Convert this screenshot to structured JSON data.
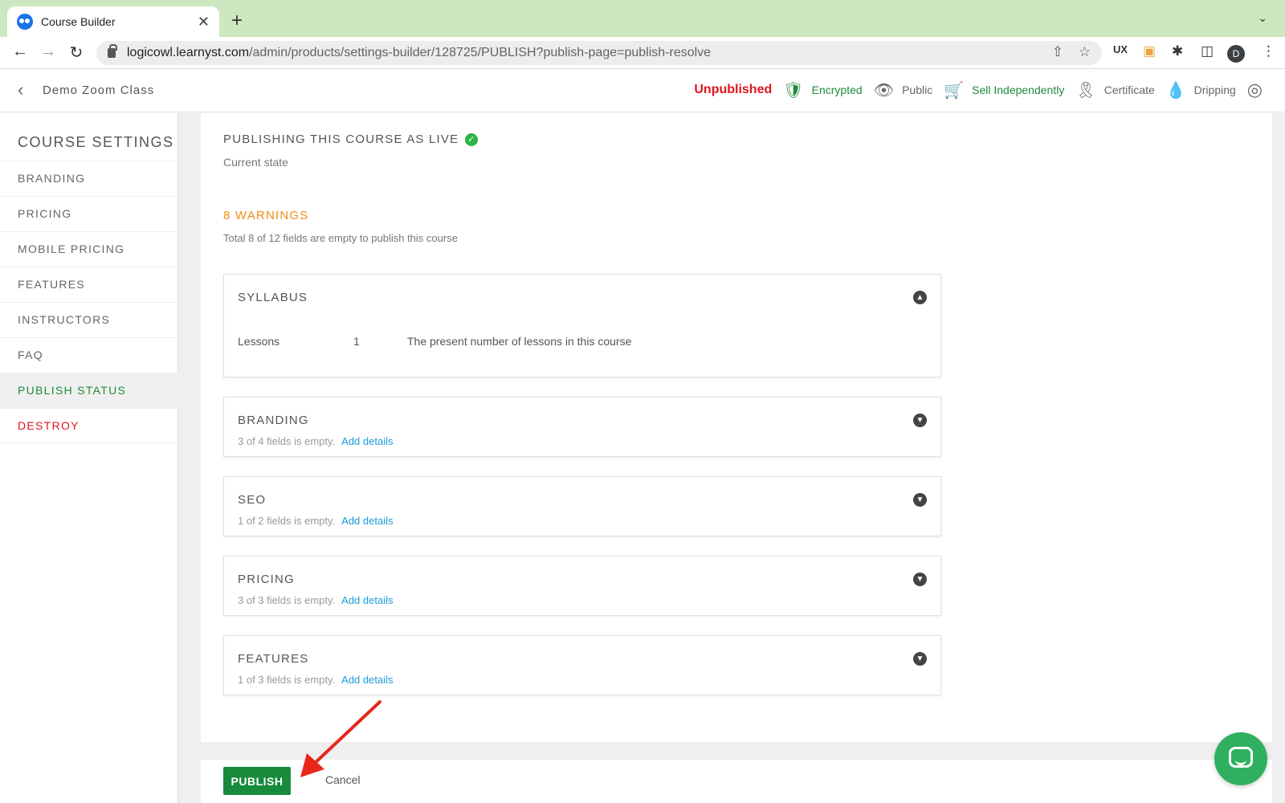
{
  "browser": {
    "tab_title": "Course Builder",
    "tab_close": "✕",
    "new_tab": "+",
    "url_host": "logicowl.learnyst.com",
    "url_path": "/admin/products/settings-builder/128725/PUBLISH?publish-page=publish-resolve",
    "profile_initial": "D"
  },
  "header": {
    "course_name": "Demo Zoom Class",
    "status": "Unpublished",
    "flags": [
      {
        "label": "Encrypted",
        "icon": "shield-check-icon"
      },
      {
        "label": "Public",
        "icon": "eye-slash-icon"
      },
      {
        "label": "Sell Independently",
        "icon": "cart-icon"
      },
      {
        "label": "Certificate",
        "icon": "award-icon"
      },
      {
        "label": "Dripping",
        "icon": "drop-icon"
      }
    ]
  },
  "sidebar": {
    "title": "COURSE SETTINGS",
    "items": [
      {
        "label": "BRANDING"
      },
      {
        "label": "PRICING"
      },
      {
        "label": "MOBILE PRICING"
      },
      {
        "label": "FEATURES"
      },
      {
        "label": "INSTRUCTORS"
      },
      {
        "label": "FAQ"
      },
      {
        "label": "PUBLISH STATUS"
      },
      {
        "label": "DESTROY"
      }
    ]
  },
  "main": {
    "live_title": "PUBLISHING THIS COURSE AS LIVE",
    "current_state": "Current state",
    "warnings_title": "8 WARNINGS",
    "warnings_desc": "Total 8 of 12 fields are empty to publish this course",
    "syllabus": {
      "title": "SYLLABUS",
      "row_label": "Lessons",
      "row_value": "1",
      "row_desc": "The present number of lessons in this course"
    },
    "panels": [
      {
        "title": "BRANDING",
        "status": "3 of 4 fields is empty.",
        "link": "Add details"
      },
      {
        "title": "SEO",
        "status": "1 of 2 fields is empty.",
        "link": "Add details"
      },
      {
        "title": "PRICING",
        "status": "3 of 3 fields is empty.",
        "link": "Add details"
      },
      {
        "title": "FEATURES",
        "status": "1 of 3 fields is empty.",
        "link": "Add details"
      }
    ]
  },
  "footer": {
    "publish_label": "PUBLISH",
    "cancel_label": "Cancel"
  },
  "colors": {
    "accent_green": "#178a3c",
    "danger_red": "#e0141e",
    "warning_orange": "#f28c10",
    "link_blue": "#1b9bd8"
  }
}
